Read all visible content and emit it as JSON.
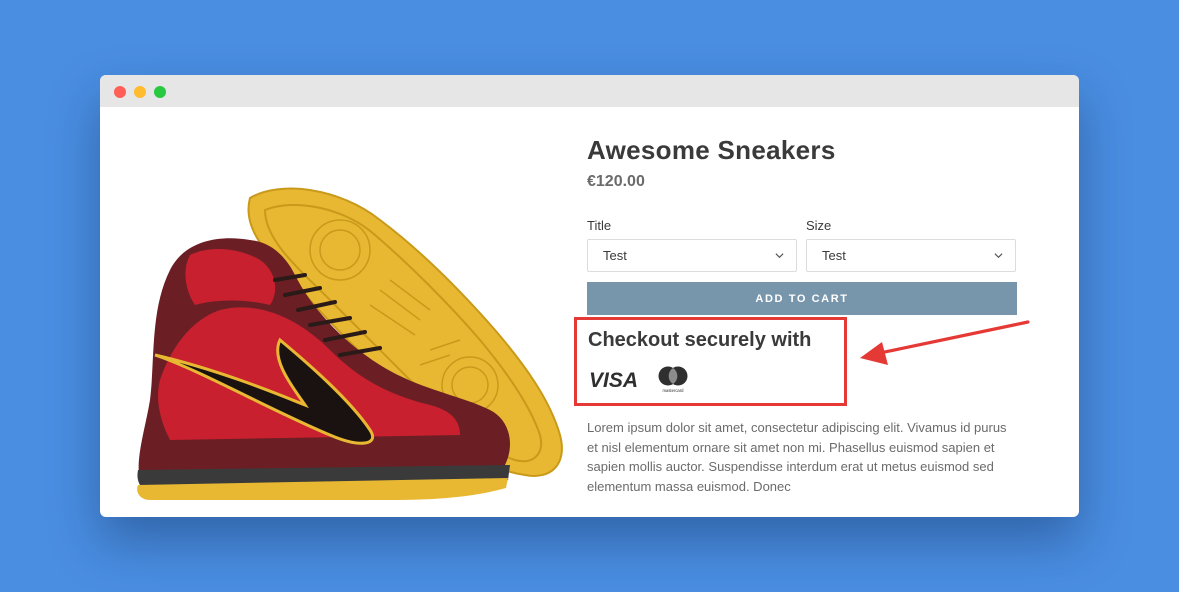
{
  "product": {
    "title": "Awesome Sneakers",
    "price": "€120.00",
    "image_alt": "red and yellow high-top sneaker"
  },
  "options": [
    {
      "label": "Title",
      "value": "Test"
    },
    {
      "label": "Size",
      "value": "Test"
    }
  ],
  "add_to_cart_label": "ADD TO CART",
  "checkout": {
    "heading": "Checkout securely with",
    "visa_label": "VISA",
    "mastercard_label": "mastercard"
  },
  "description": " Lorem ipsum dolor sit amet, consectetur adipiscing elit. Vivamus id purus et nisl elementum ornare sit amet non mi. Phasellus euismod sapien et sapien mollis auctor. Suspendisse interdum erat ut metus euismod sed elementum massa euismod. Donec",
  "colors": {
    "background": "#4a8ee2",
    "button": "#7896ab",
    "highlight": "#e53935"
  },
  "icons": [
    "close-dot-icon",
    "minimize-dot-icon",
    "maximize-dot-icon",
    "chevron-down-icon",
    "visa-icon",
    "mastercard-icon",
    "arrow-icon"
  ]
}
